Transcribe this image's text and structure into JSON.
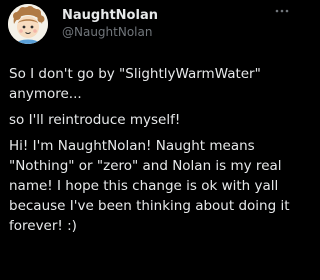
{
  "author": {
    "display_name": "NaughtNolan",
    "handle": "@NaughtNolan",
    "avatar_icon": "cartoon-avatar-icon"
  },
  "actions": {
    "more_icon": "more-dots-icon"
  },
  "tweet": {
    "paragraphs": [
      "So I don't go by \"SlightlyWarmWater\" anymore...",
      "so I'll reintroduce myself!",
      "Hi! I'm NaughtNolan! Naught means \"Nothing\" or \"zero\" and Nolan is my real name! I hope this change is ok with yall because I've been thinking about doing it forever! :)"
    ]
  },
  "colors": {
    "background": "#000000",
    "text_primary": "#e7e9ea",
    "text_secondary": "#71767b"
  }
}
